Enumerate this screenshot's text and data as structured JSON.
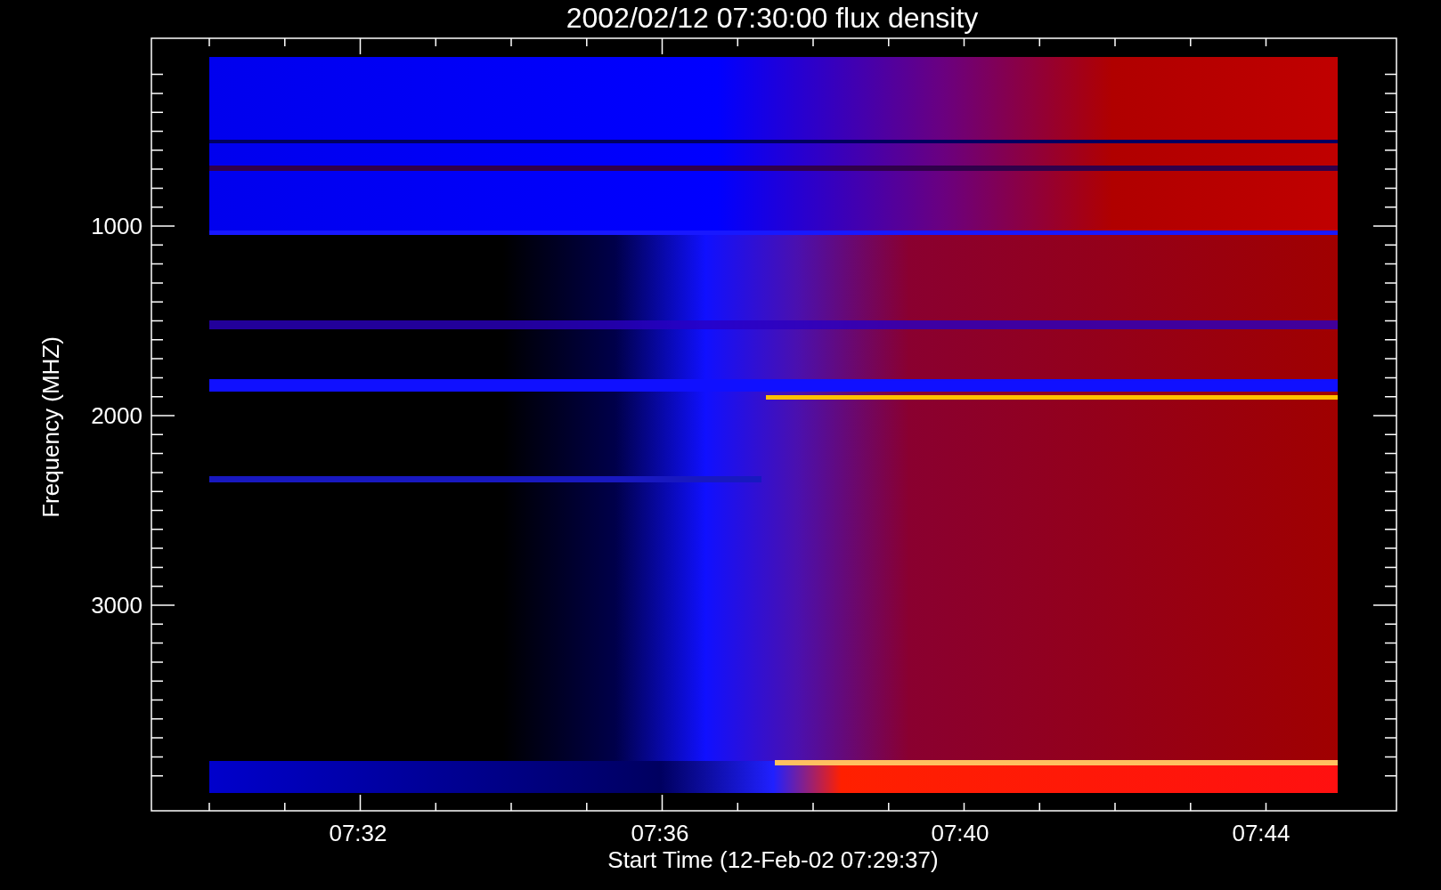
{
  "plot": {
    "title": "2002/02/12 07:30:00 flux density",
    "y_axis": {
      "label": "Frequency (MHZ)",
      "tick_labels": [
        "1000",
        "2000",
        "3000"
      ]
    },
    "x_axis": {
      "label": "Start Time (12-Feb-02 07:29:37)",
      "tick_labels": [
        "07:32",
        "07:36",
        "07:40",
        "07:44"
      ]
    }
  }
}
